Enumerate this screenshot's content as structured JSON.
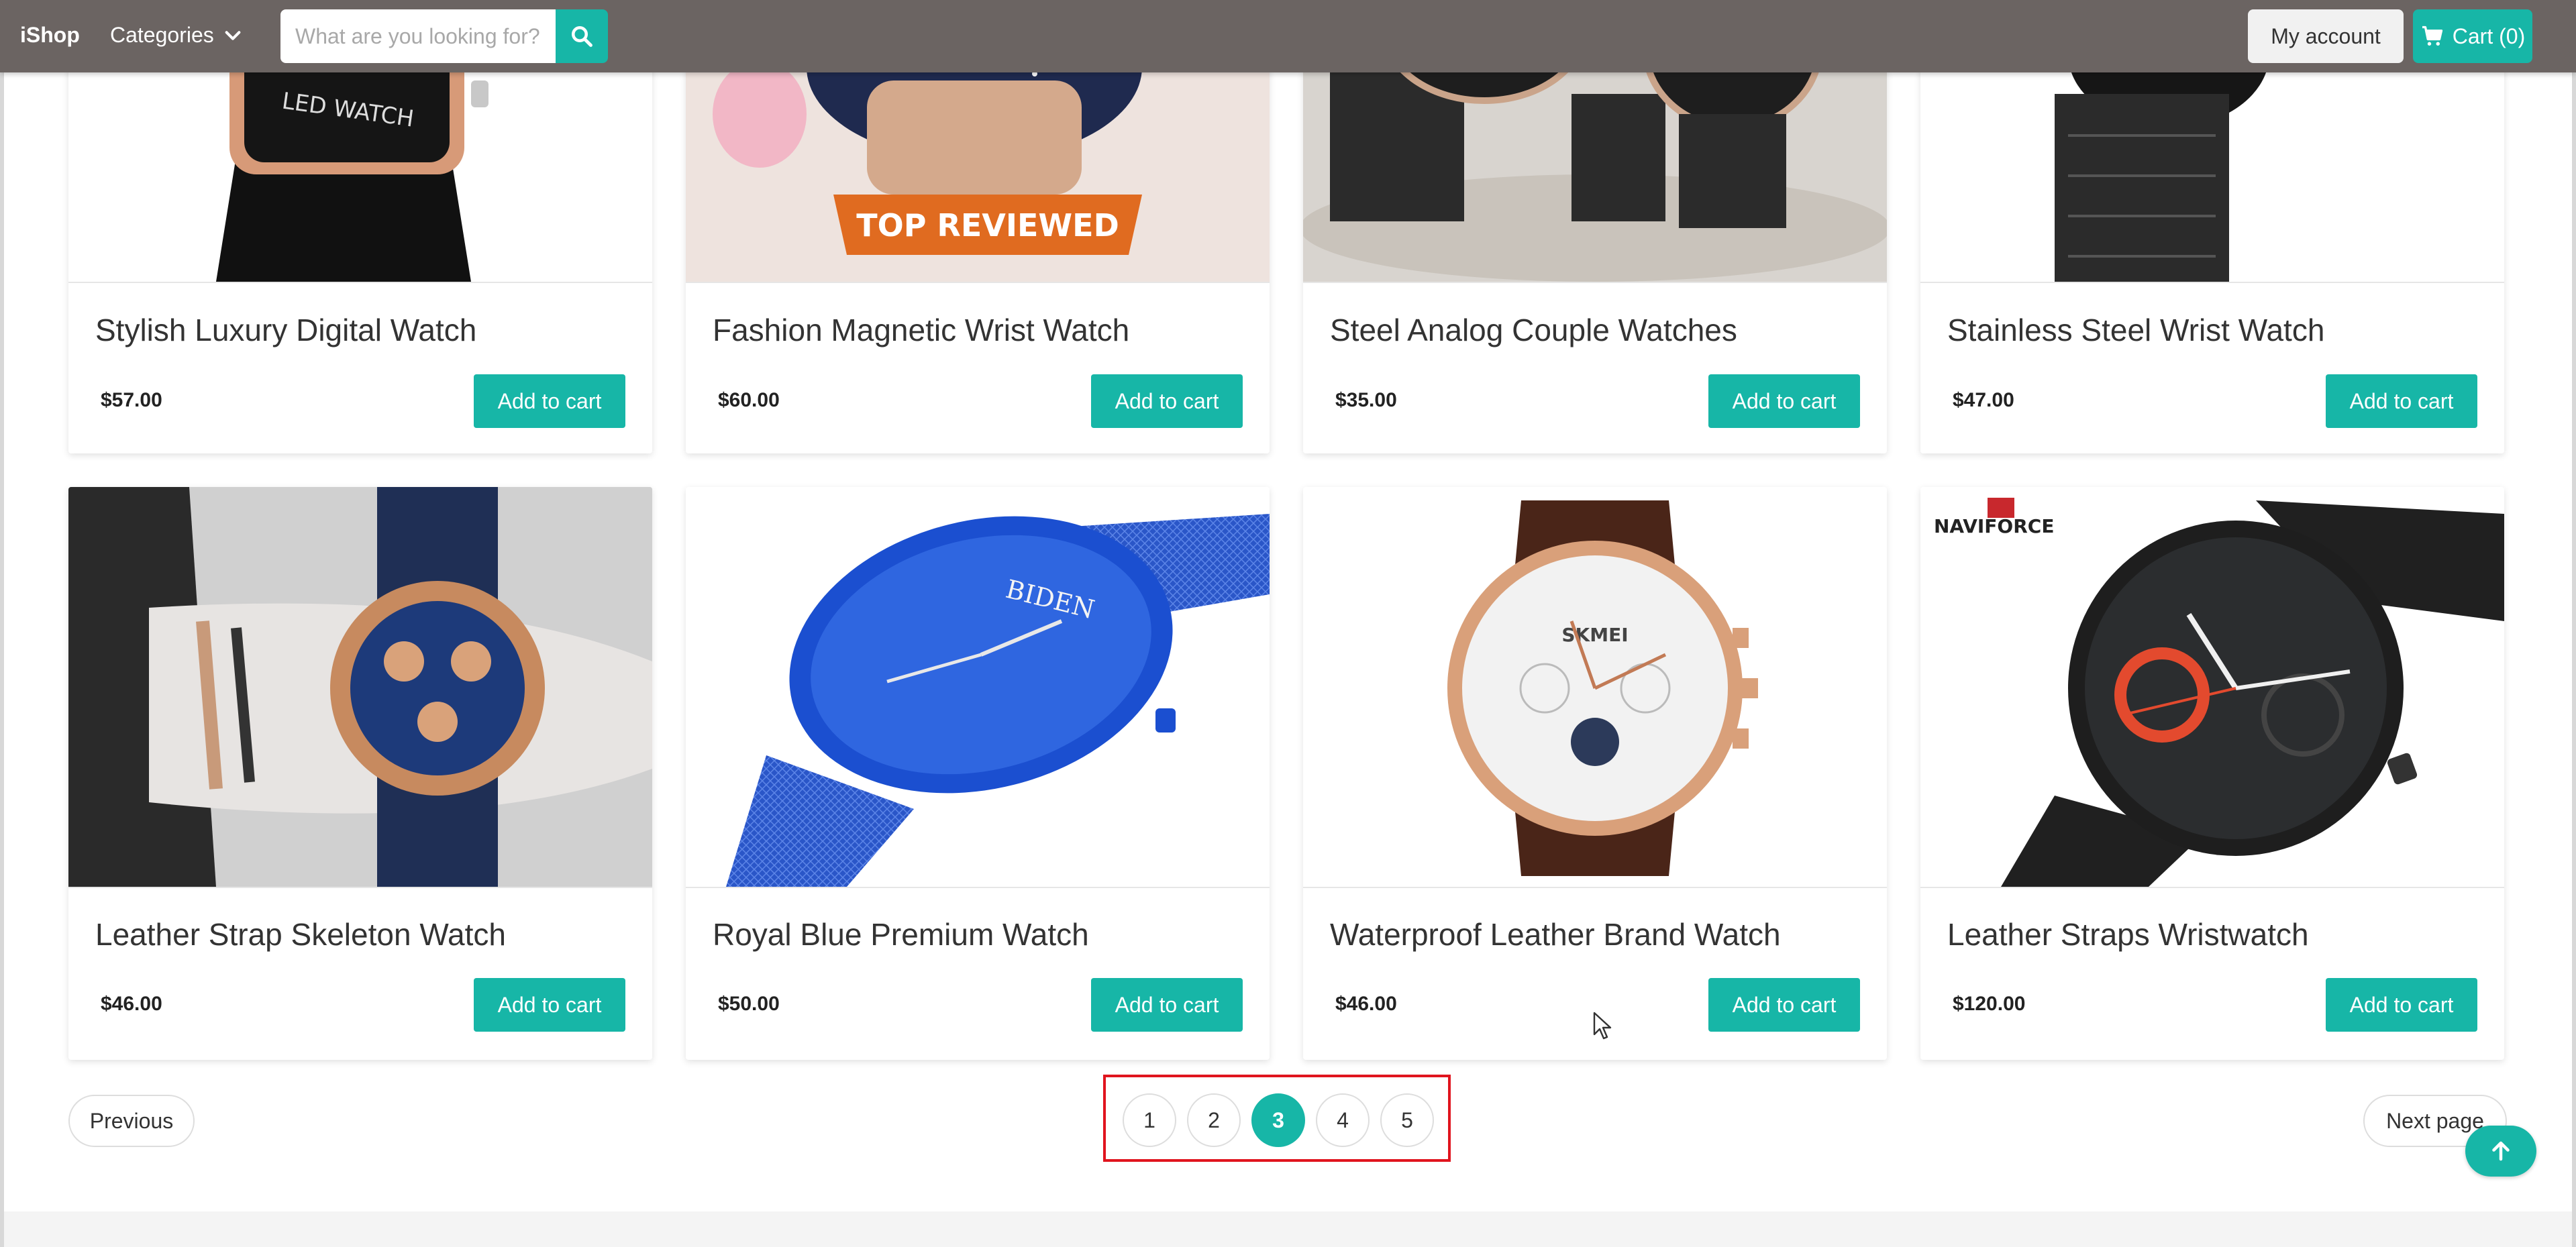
{
  "header": {
    "brand": "iShop",
    "categories_label": "Categories",
    "search_placeholder": "What are you looking for?",
    "my_account": "My account",
    "cart_label": "Cart (0)"
  },
  "products": [
    {
      "title": "Stylish Luxury Digital Watch",
      "price": "$57.00",
      "button": "Add to cart",
      "image_text": "LED WATCH"
    },
    {
      "title": "Fashion Magnetic Wrist Watch",
      "price": "$60.00",
      "button": "Add to cart",
      "image_text": "TOP REVIEWED"
    },
    {
      "title": "Steel Analog Couple Watches",
      "price": "$35.00",
      "button": "Add to cart"
    },
    {
      "title": "Stainless Steel Wrist Watch",
      "price": "$47.00",
      "button": "Add to cart"
    },
    {
      "title": "Leather Strap Skeleton Watch",
      "price": "$46.00",
      "button": "Add to cart"
    },
    {
      "title": "Royal Blue Premium Watch",
      "price": "$50.00",
      "button": "Add to cart",
      "image_text": "BIDEN"
    },
    {
      "title": "Waterproof Leather Brand Watch",
      "price": "$46.00",
      "button": "Add to cart",
      "image_text": "SKMEI"
    },
    {
      "title": "Leather Straps Wristwatch",
      "price": "$120.00",
      "button": "Add to cart",
      "image_text": "NAVIFORCE"
    }
  ],
  "pagination": {
    "previous": "Previous",
    "next": "Next page",
    "pages": [
      "1",
      "2",
      "3",
      "4",
      "5"
    ],
    "current": "3"
  },
  "colors": {
    "accent": "#17b6a7",
    "header_bg": "#6b6462",
    "highlight": "#e0141e"
  }
}
